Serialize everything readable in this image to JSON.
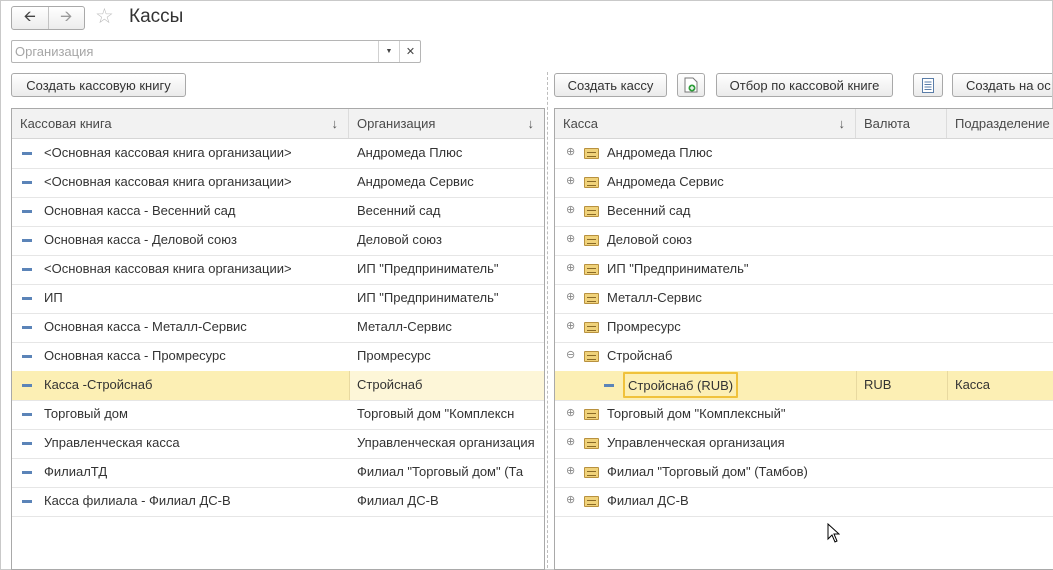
{
  "title": "Кассы",
  "org_filter": {
    "placeholder": "Организация",
    "value": ""
  },
  "left_toolbar": {
    "create_book": "Создать кассовую книгу"
  },
  "right_toolbar": {
    "create_cash": "Создать кассу",
    "filter_by_book": "Отбор по кассовой книге",
    "create_based": "Создать на ос"
  },
  "left_table": {
    "columns": [
      "Кассовая книга",
      "Организация"
    ],
    "rows": [
      {
        "book": "<Основная кассовая книга организации>",
        "org": "Андромеда Плюс",
        "selected": false
      },
      {
        "book": "<Основная кассовая книга организации>",
        "org": "Андромеда Сервис",
        "selected": false
      },
      {
        "book": "Основная касса - Весенний сад",
        "org": "Весенний сад",
        "selected": false
      },
      {
        "book": "Основная касса - Деловой союз",
        "org": "Деловой союз",
        "selected": false
      },
      {
        "book": "<Основная кассовая книга организации>",
        "org": "ИП \"Предприниматель\"",
        "selected": false
      },
      {
        "book": "ИП",
        "org": "ИП \"Предприниматель\"",
        "selected": false
      },
      {
        "book": "Основная касса - Металл-Сервис",
        "org": "Металл-Сервис",
        "selected": false
      },
      {
        "book": "Основная касса - Промресурс",
        "org": "Промресурс",
        "selected": false
      },
      {
        "book": "Касса -Стройснаб",
        "org": "Стройснаб",
        "selected": true
      },
      {
        "book": "Торговый дом",
        "org": "Торговый дом \"Комплексн",
        "selected": false
      },
      {
        "book": "Управленческая касса",
        "org": "Управленческая организация",
        "selected": false
      },
      {
        "book": "ФилиалТД",
        "org": "Филиал \"Торговый дом\" (Та",
        "selected": false
      },
      {
        "book": "Касса филиала - Филиал ДС-В",
        "org": "Филиал ДС-В",
        "selected": false
      }
    ]
  },
  "right_table": {
    "columns": [
      "Касса",
      "Валюта",
      "Подразделение"
    ],
    "rows": [
      {
        "name": "Андромеда Плюс",
        "kind": "group",
        "expanded": false
      },
      {
        "name": "Андромеда Сервис",
        "kind": "group",
        "expanded": false
      },
      {
        "name": "Весенний сад",
        "kind": "group",
        "expanded": false
      },
      {
        "name": "Деловой союз",
        "kind": "group",
        "expanded": false
      },
      {
        "name": "ИП \"Предприниматель\"",
        "kind": "group",
        "expanded": false
      },
      {
        "name": "Металл-Сервис",
        "kind": "group",
        "expanded": false
      },
      {
        "name": "Промресурс",
        "kind": "group",
        "expanded": false
      },
      {
        "name": "Стройснаб",
        "kind": "group",
        "expanded": true
      },
      {
        "name": "Стройснаб (RUB)",
        "kind": "item",
        "currency": "RUB",
        "dept": "Касса",
        "selected": true
      },
      {
        "name": "Торговый дом \"Комплексный\"",
        "kind": "group",
        "expanded": false
      },
      {
        "name": "Управленческая организация",
        "kind": "group",
        "expanded": false
      },
      {
        "name": "Филиал \"Торговый дом\" (Тамбов)",
        "kind": "group",
        "expanded": false
      },
      {
        "name": "Филиал ДС-В",
        "kind": "group",
        "expanded": false
      }
    ]
  },
  "icons": {
    "back": "arrow-left-icon",
    "forward": "arrow-right-icon",
    "favorite": "star-icon",
    "dropdown": "chevron-down-icon",
    "clear": "close-icon",
    "add_copy": "add-document-icon",
    "list": "list-icon",
    "sort": "sort-down-icon",
    "group": "folder-icon",
    "item": "cash-item-icon"
  },
  "colors": {
    "selected_row": "#fcefb4",
    "focus_border": "#f0c23c",
    "item_icon": "#5b84b8"
  }
}
